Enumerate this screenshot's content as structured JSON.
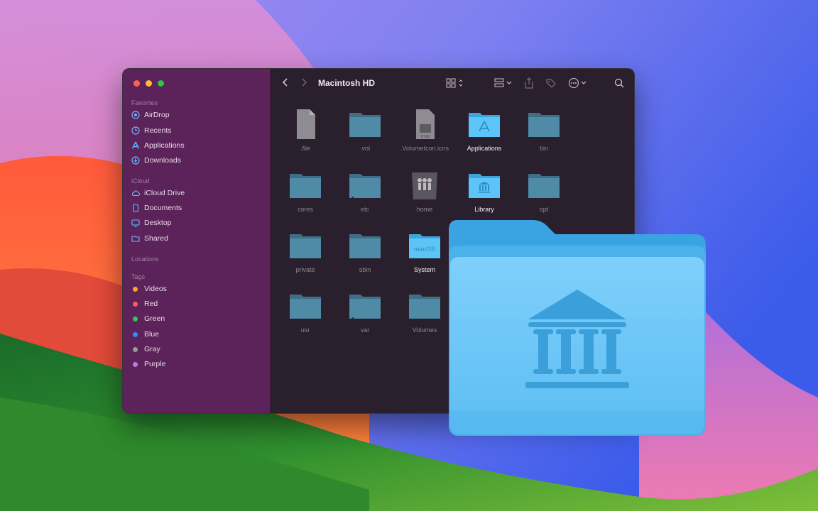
{
  "window": {
    "title": "Macintosh HD"
  },
  "sidebar": {
    "sections": {
      "favorites": "Favorites",
      "icloud": "iCloud",
      "locations": "Locations",
      "tags": "Tags"
    },
    "favorites": [
      {
        "label": "AirDrop",
        "icon": "airdrop-icon"
      },
      {
        "label": "Recents",
        "icon": "clock-icon"
      },
      {
        "label": "Applications",
        "icon": "applications-icon"
      },
      {
        "label": "Downloads",
        "icon": "download-icon"
      }
    ],
    "icloud": [
      {
        "label": "iCloud Drive",
        "icon": "cloud-icon"
      },
      {
        "label": "Documents",
        "icon": "document-icon"
      },
      {
        "label": "Desktop",
        "icon": "desktop-icon"
      },
      {
        "label": "Shared",
        "icon": "shared-folder-icon"
      }
    ],
    "tags": [
      {
        "label": "Videos",
        "color": "#f5a623"
      },
      {
        "label": "Red",
        "color": "#ff5b57"
      },
      {
        "label": "Green",
        "color": "#34c759"
      },
      {
        "label": "Blue",
        "color": "#2f8cff"
      },
      {
        "label": "Gray",
        "color": "#9a9a9e"
      },
      {
        "label": "Purple",
        "color": "#c07ad6"
      }
    ]
  },
  "files": [
    {
      "name": ".file",
      "type": "document"
    },
    {
      "name": ".vol",
      "type": "folder"
    },
    {
      "name": ".VolumeIcon.icns",
      "type": "icns"
    },
    {
      "name": "Applications",
      "type": "applications"
    },
    {
      "name": "bin",
      "type": "folder"
    },
    {
      "name": "cores",
      "type": "folder"
    },
    {
      "name": "etc",
      "type": "alias-folder"
    },
    {
      "name": "home",
      "type": "home"
    },
    {
      "name": "Library",
      "type": "library"
    },
    {
      "name": "opt",
      "type": "folder"
    },
    {
      "name": "private",
      "type": "folder"
    },
    {
      "name": "sbin",
      "type": "folder"
    },
    {
      "name": "System",
      "type": "macos"
    },
    {
      "name": "usr",
      "type": "folder"
    },
    {
      "name": "var",
      "type": "alias-folder"
    },
    {
      "name": "Volumes",
      "type": "folder"
    }
  ],
  "system_badge": "macOS",
  "colors": {
    "sidebar": "#5b2359",
    "content": "#2a1f2c",
    "folder_dim": "#4f8aa6",
    "folder_bright": "#5cc4f6"
  }
}
